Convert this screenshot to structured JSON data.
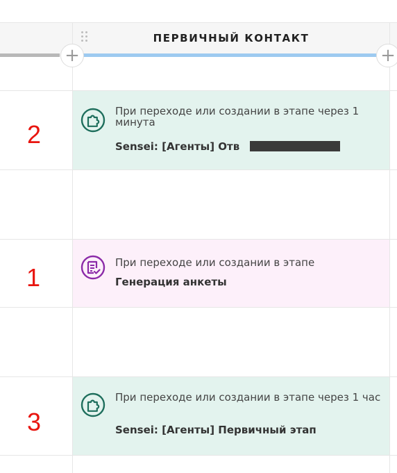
{
  "column": {
    "stage_title": "ПЕРВИЧНЫЙ КОНТАКТ",
    "add_label": "+"
  },
  "colors": {
    "progress_left": "#b8b8b8",
    "progress_stage": "#9dcaf0",
    "card_green": "#e3f3ee",
    "card_pink": "#fdf0fa",
    "annotation_red": "#e8150f"
  },
  "triggers": [
    {
      "icon": "puzzle-icon",
      "condition": "При переходе или создании в этапе через 1 минута",
      "name": "Sensei: [Агенты] Отв",
      "annotation": "2"
    },
    {
      "icon": "form-icon",
      "condition": "При переходе или создании в этапе",
      "name": "Генерация анкеты",
      "annotation": "1"
    },
    {
      "icon": "puzzle-icon",
      "condition": "При переходе или создании в этапе через 1 час",
      "name": "Sensei: [Агенты] Первичный этап",
      "annotation": "3"
    }
  ]
}
